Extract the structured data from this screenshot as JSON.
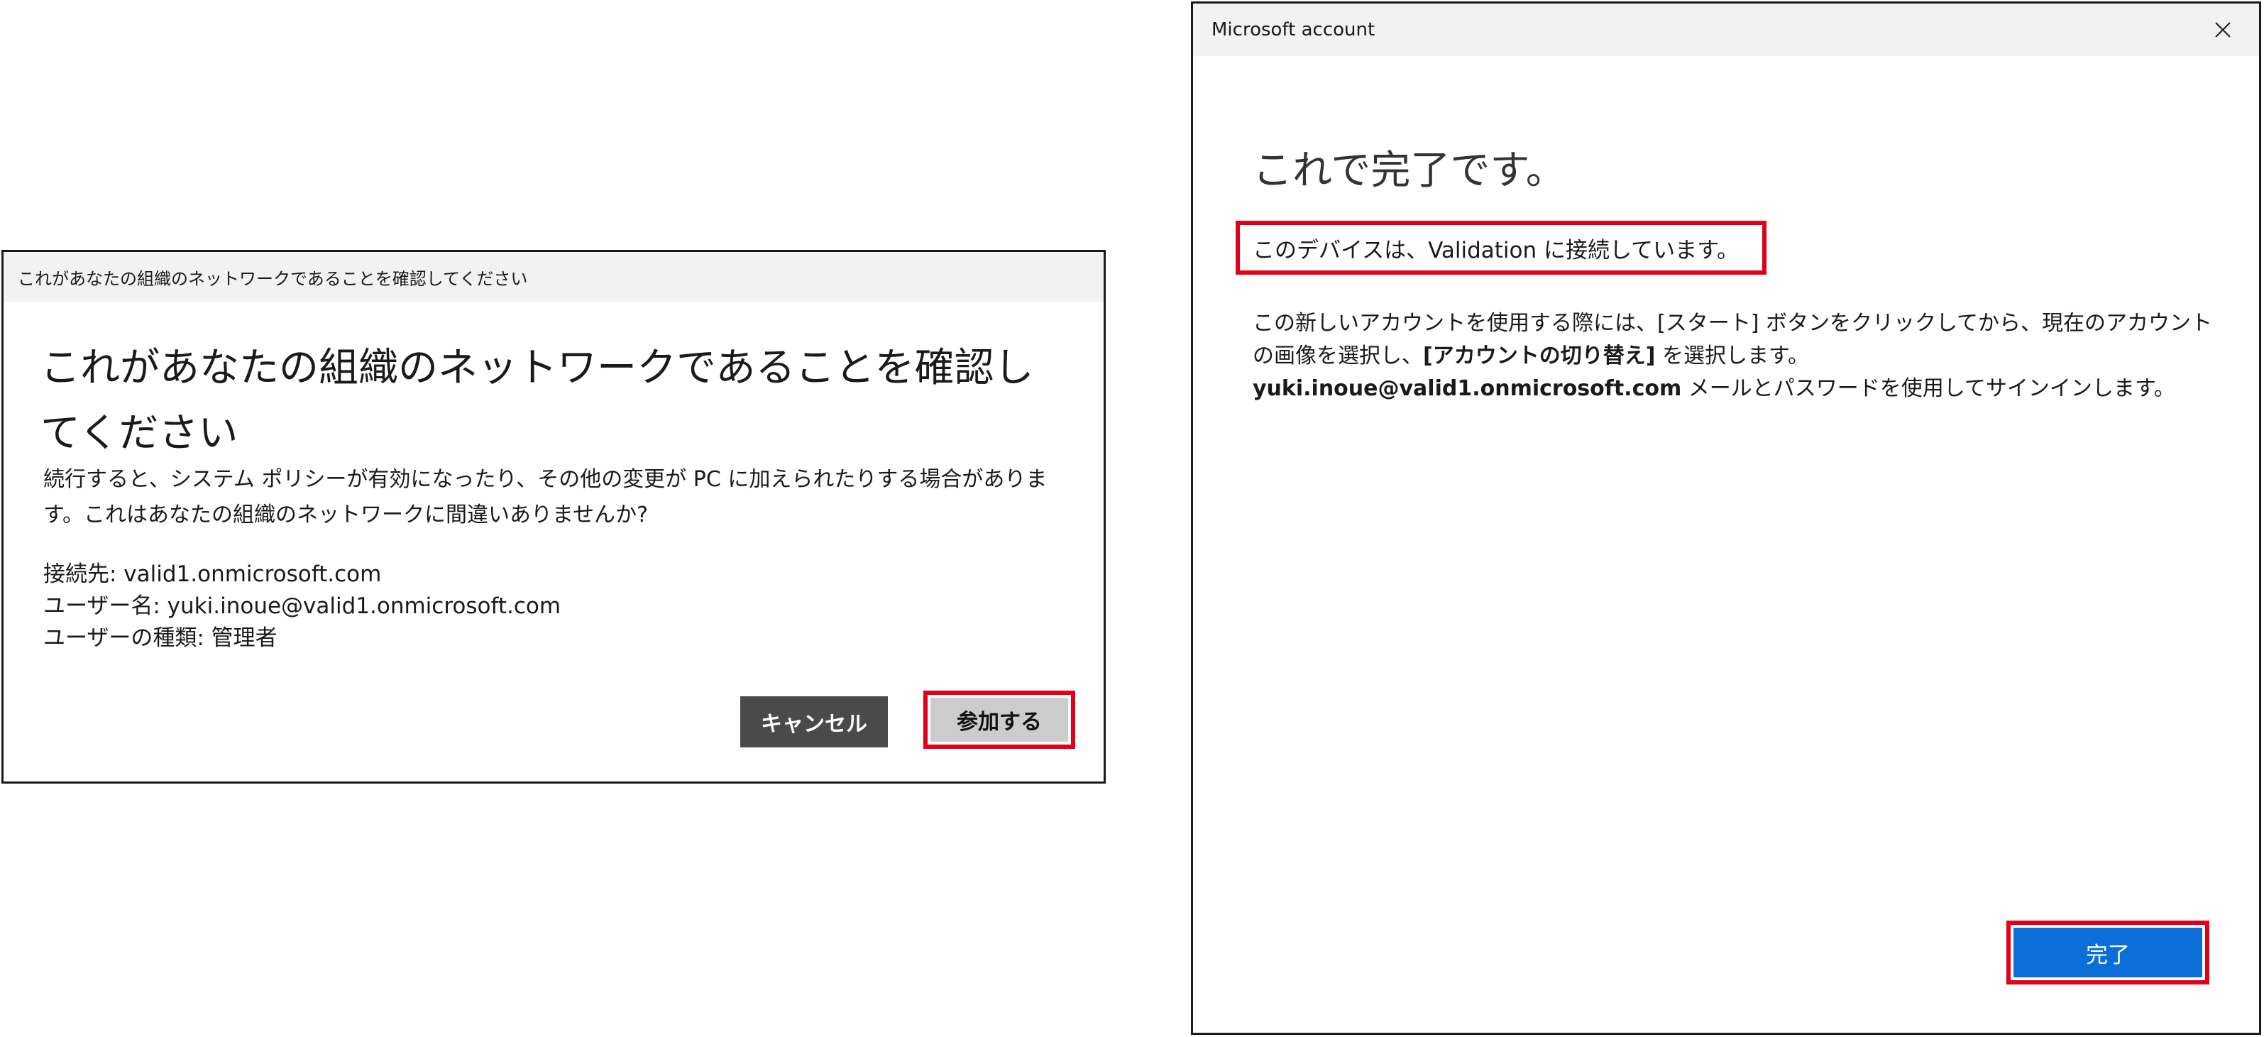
{
  "join_dialog": {
    "window_title": "これがあなたの組織のネットワークであることを確認してください",
    "heading": "これがあなたの組織のネットワークであることを確認してください",
    "description": "続行すると、システム ポリシーが有効になったり、その他の変更が PC に加えられたりする場合があります。これはあなたの組織のネットワークに間違いありませんか?",
    "info": {
      "connect_to": "接続先: valid1.onmicrosoft.com",
      "user_name": "ユーザー名: yuki.inoue@valid1.onmicrosoft.com",
      "user_type": "ユーザーの種類: 管理者"
    },
    "cancel_label": "キャンセル",
    "join_label": "参加する"
  },
  "account_window": {
    "window_title": "Microsoft account",
    "heading": "これで完了です。",
    "connected_message": "このデバイスは、Validation に接続しています。",
    "instructions": {
      "part1": "この新しいアカウントを使用する際には、",
      "start_button": "[スタート]",
      "part2": " ボタンをクリックしてから、現在のアカウントの画像を選択し、",
      "switch_account": "[アカウントの切り替え]",
      "part3": " を選択します。",
      "email": "yuki.inoue@valid1.onmicrosoft.com",
      "part4": " メールとパスワードを使用してサインインします。"
    },
    "done_label": "完了"
  },
  "colors": {
    "highlight_border": "#e0001a",
    "done_button": "#0a6fd8",
    "cancel_button": "#4a4a4a",
    "join_button": "#cccccc"
  },
  "icons": {
    "close": "close-icon"
  }
}
